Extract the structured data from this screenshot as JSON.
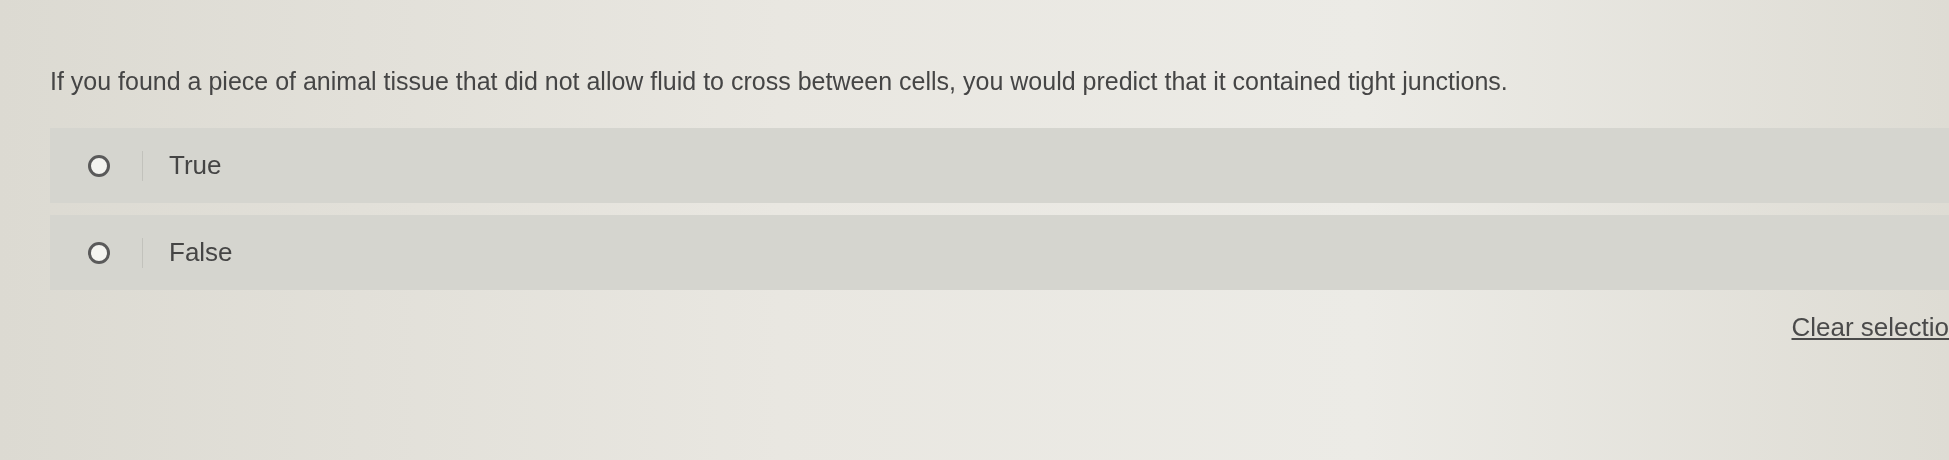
{
  "question": "If you found a piece of animal tissue that did not allow fluid to cross between cells, you would predict that it contained tight junctions.",
  "options": [
    {
      "label": "True",
      "selected": false
    },
    {
      "label": "False",
      "selected": false
    }
  ],
  "clear_link": "Clear selectio"
}
